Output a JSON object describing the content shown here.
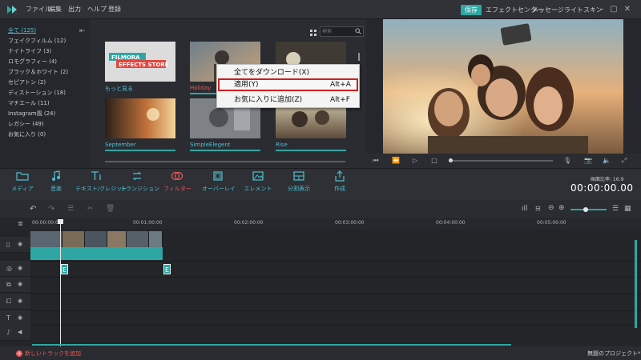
{
  "titlebar": {
    "menus": [
      "ファイル",
      "編集",
      "出力",
      "ヘルプ",
      "登録"
    ],
    "save_label": "保存",
    "effect_center_label": "エフェクトセンター",
    "message_label": "メッセージ",
    "light_skin_label": "ライトスキン"
  },
  "categories": [
    {
      "label": "全て (125)",
      "active": true
    },
    {
      "label": "フェイクフィルム (12)"
    },
    {
      "label": "ナイトライフ (3)"
    },
    {
      "label": "ロモグラフィー (4)"
    },
    {
      "label": "ブラック＆ホワイト (2)"
    },
    {
      "label": "セピアトン (2)"
    },
    {
      "label": "ディストーション (18)"
    },
    {
      "label": "マチエール (11)"
    },
    {
      "label": "Instagram風 (24)"
    },
    {
      "label": "レガシー (49)"
    },
    {
      "label": "お気に入り (0)"
    }
  ],
  "search": {
    "placeholder": "検索"
  },
  "thumbnails": [
    {
      "label": "もっと見る",
      "store_line1": "FILMORA",
      "store_line2": "EFFECTS STORE"
    },
    {
      "label": "Holiday"
    },
    {
      "label": ""
    },
    {
      "label": "September"
    },
    {
      "label": "SimpleElegent"
    },
    {
      "label": "Rise"
    }
  ],
  "context_menu": [
    {
      "label": "全てをダウンロード(X)",
      "shortcut": ""
    },
    {
      "label": "適用(Y)",
      "shortcut": "Alt+A"
    },
    {
      "label": "お気に入りに追加(Z)",
      "shortcut": "Alt+F"
    }
  ],
  "toolbar": [
    {
      "label": "メディア",
      "icon": "folder-icon"
    },
    {
      "label": "音楽",
      "icon": "music-note-icon"
    },
    {
      "label": "テキスト/クレジット",
      "icon": "text-icon"
    },
    {
      "label": "トランジション",
      "icon": "transition-icon"
    },
    {
      "label": "フィルター",
      "icon": "filter-icon",
      "active": true
    },
    {
      "label": "オーバーレイ",
      "icon": "overlay-icon"
    },
    {
      "label": "エレメント",
      "icon": "image-icon"
    },
    {
      "label": "分割表示",
      "icon": "split-screen-icon"
    },
    {
      "label": "作成",
      "icon": "export-icon"
    }
  ],
  "aspect": {
    "label": "画面比率: 16:9"
  },
  "timecode": "00:00:00.00",
  "ruler": [
    "00:00:00:00",
    "00:01:00:00",
    "00:02:00:00",
    "00:03:00:00",
    "00:04:00:00",
    "00:05:00:00"
  ],
  "fx_badge": "E",
  "bottom": {
    "add_track": "新しいトラックを追加",
    "project_name": "無題のプロジェクト*"
  },
  "colors": {
    "accent": "#2ea7a4",
    "highlight_red": "#d01f1f",
    "label_cyan": "#4fc0d0"
  }
}
